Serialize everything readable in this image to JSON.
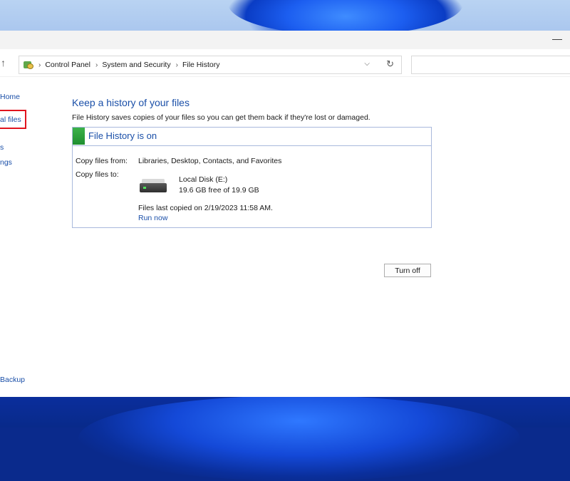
{
  "window": {
    "minimize_glyph": "—"
  },
  "address": {
    "crumbs": [
      "Control Panel",
      "System and Security",
      "File History"
    ],
    "search_placeholder": ""
  },
  "sidebar": {
    "items": [
      {
        "label": "Home"
      },
      {
        "label": "al files"
      },
      {
        "label": "s"
      },
      {
        "label": "ngs"
      },
      {
        "label": "Backup"
      }
    ]
  },
  "main": {
    "heading": "Keep a history of your files",
    "description": "File History saves copies of your files so you can get them back if they're lost or damaged.",
    "panel": {
      "title": "File History is on",
      "status_color": "#2aa83a",
      "copy_from_label": "Copy files from:",
      "copy_from_value": "Libraries, Desktop, Contacts, and Favorites",
      "copy_to_label": "Copy files to:",
      "drive_name": "Local Disk (E:)",
      "drive_space": "19.6 GB free of 19.9 GB",
      "last_copied": "Files last copied on 2/19/2023 11:58 AM.",
      "run_now": "Run now"
    },
    "turn_off": "Turn off"
  },
  "colors": {
    "link": "#1a4fa8",
    "highlight": "#e0141e"
  }
}
